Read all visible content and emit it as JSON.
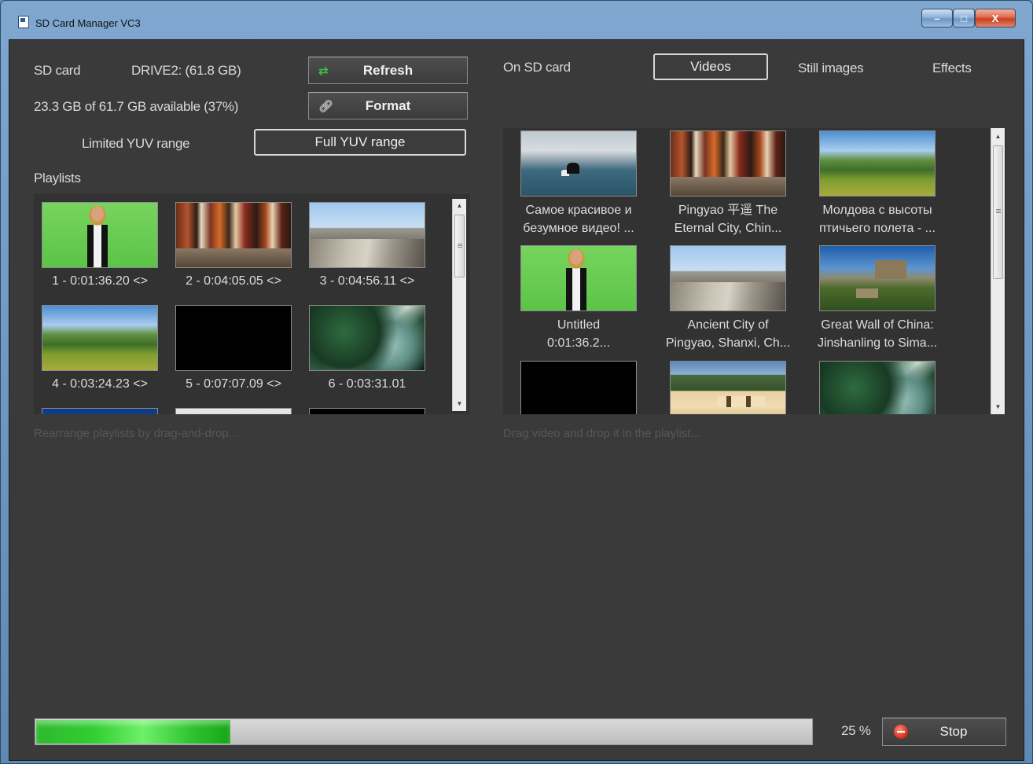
{
  "window": {
    "title": "SD Card Manager VC3",
    "controls": {
      "minimize": "–",
      "maximize": "□",
      "close": "X"
    }
  },
  "left": {
    "sd_card_label": "SD card",
    "drive": "DRIVE2: (61.8 GB)",
    "available": "23.3 GB of 61.7 GB available (37%)",
    "refresh_label": "Refresh",
    "format_label": "Format",
    "limited_yuv_label": "Limited YUV range",
    "full_yuv_label": "Full YUV range",
    "playlists_heading": "Playlists",
    "playlists": [
      {
        "caption": "1 - 0:01:36.20 <>",
        "thumb": "green-screen-presenter"
      },
      {
        "caption": "2 - 0:04:05.05 <>",
        "thumb": "market-street"
      },
      {
        "caption": "3 - 0:04:56.11 <>",
        "thumb": "city-wall"
      },
      {
        "caption": "4 - 0:03:24.23 <>",
        "thumb": "hill-aerial"
      },
      {
        "caption": "5 - 0:07:07.09 <>",
        "thumb": "black"
      },
      {
        "caption": "6 - 0:03:31.01",
        "thumb": "forest-aerial"
      }
    ],
    "hint": "Rearrange playlists by drag-and-drop..."
  },
  "right": {
    "on_sd_card_label": "On SD card",
    "tabs": {
      "videos": "Videos",
      "still_images": "Still images",
      "effects": "Effects"
    },
    "videos": [
      {
        "line1": "Самое красивое и",
        "line2": "безумное видео! ...",
        "thumb": "sea-jetski"
      },
      {
        "line1": "Pingyao 平遥 The",
        "line2": "Eternal City, Chin...",
        "thumb": "market-street"
      },
      {
        "line1": "Молдова с высоты",
        "line2": "птичьего полета - ...",
        "thumb": "hill-aerial"
      },
      {
        "line1": "Untitled",
        "line2": "0:01:36.2...",
        "thumb": "green-screen-presenter"
      },
      {
        "line1": "Ancient City of",
        "line2": "Pingyao, Shanxi, Ch...",
        "thumb": "city-wall"
      },
      {
        "line1": "Great Wall of China:",
        "line2": "Jinshanling to Sima...",
        "thumb": "great-wall"
      },
      {
        "line1": "",
        "line2": "",
        "thumb": "black"
      },
      {
        "line1": "",
        "line2": "",
        "thumb": "building"
      },
      {
        "line1": "",
        "line2": "",
        "thumb": "forest-aerial"
      }
    ],
    "hint": "Drag video and drop it in the playlist..."
  },
  "status": {
    "progress": 0.25,
    "percent_label": "25 %",
    "stop_label": "Stop"
  },
  "colors": {
    "window_bg": "#3a3a3a",
    "progress_green": "#31cf31",
    "title_bar": "#6e98c3"
  },
  "icons": {
    "refresh": "refresh-arrows-icon",
    "format": "format-wrench-icon",
    "stop": "stop-icon",
    "app": "sd-card-app-icon"
  }
}
